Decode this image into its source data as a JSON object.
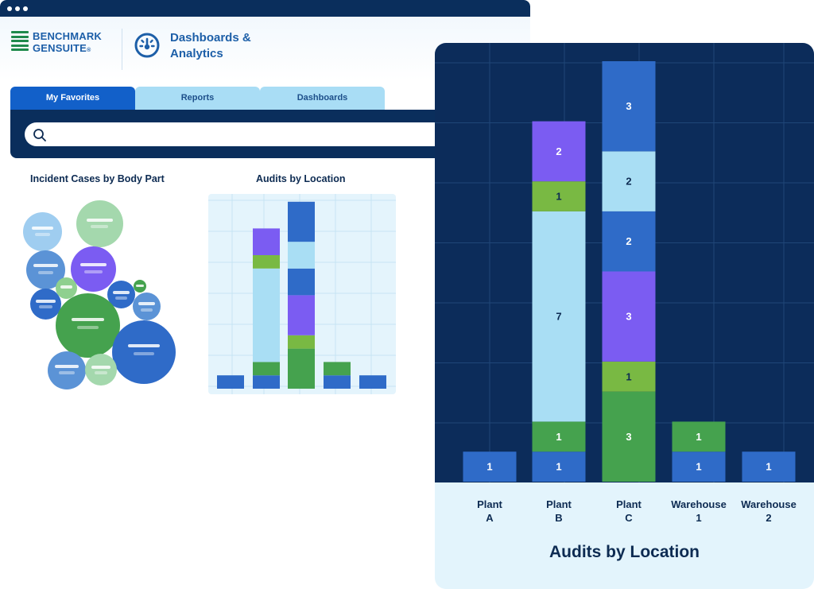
{
  "window": {
    "logo_line1": "BENCHMARK",
    "logo_line2": "GENSUITE",
    "logo_mark": "®",
    "app_title_line1": "Dashboards &",
    "app_title_line2": "Analytics",
    "app_icon": "gauge-icon"
  },
  "tabs": [
    {
      "label": "My Favorites",
      "active": true
    },
    {
      "label": "Reports",
      "active": false
    },
    {
      "label": "Dashboards",
      "active": false
    }
  ],
  "search": {
    "icon": "search-icon",
    "placeholder": ""
  },
  "panels": {
    "bubble_title": "Incident Cases by Body Part",
    "mini_title": "Audits by Location"
  },
  "colors": {
    "navy": "#0c2c5a",
    "blue": "#2f6bc8",
    "light_blue": "#a9def4",
    "purple": "#7b5cf2",
    "lime": "#79b943",
    "green": "#45a24e",
    "panel_bg": "#e3f4fc"
  },
  "chart_data": {
    "type": "bar",
    "stacked": true,
    "title": "Audits by Location",
    "categories": [
      "Plant A",
      "Plant B",
      "Plant C",
      "Warehouse 1",
      "Warehouse 2"
    ],
    "category_lines": [
      [
        "Plant",
        "A"
      ],
      [
        "Plant",
        "B"
      ],
      [
        "Plant",
        "C"
      ],
      [
        "Warehouse",
        "1"
      ],
      [
        "Warehouse",
        "2"
      ]
    ],
    "stacks": [
      [
        {
          "value": 1,
          "color": "#2f6bc8"
        }
      ],
      [
        {
          "value": 1,
          "color": "#2f6bc8"
        },
        {
          "value": 1,
          "color": "#45a24e"
        },
        {
          "value": 7,
          "color": "#a9def4"
        },
        {
          "value": 1,
          "color": "#79b943"
        },
        {
          "value": 2,
          "color": "#7b5cf2"
        }
      ],
      [
        {
          "value": 3,
          "color": "#45a24e"
        },
        {
          "value": 1,
          "color": "#79b943"
        },
        {
          "value": 3,
          "color": "#7b5cf2"
        },
        {
          "value": 2,
          "color": "#2f6bc8"
        },
        {
          "value": 2,
          "color": "#a9def4"
        },
        {
          "value": 3,
          "color": "#2f6bc8"
        }
      ],
      [
        {
          "value": 1,
          "color": "#2f6bc8"
        },
        {
          "value": 1,
          "color": "#45a24e"
        }
      ],
      [
        {
          "value": 1,
          "color": "#2f6bc8"
        }
      ]
    ],
    "ylim": [
      0,
      14
    ],
    "grid": true,
    "xlabel": "",
    "ylabel": ""
  }
}
